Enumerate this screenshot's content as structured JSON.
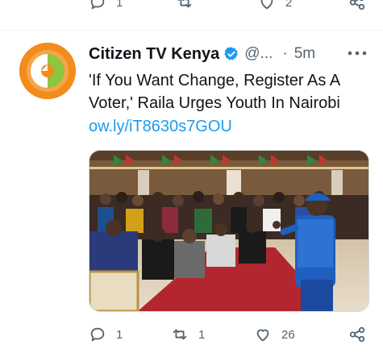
{
  "previous_tweet": {
    "reply_count": "1",
    "like_count": "2"
  },
  "tweet": {
    "author_name": "Citizen TV Kenya",
    "handle": "@...",
    "separator": "·",
    "time": "5m",
    "text": "'If You Want Change, Register As A Voter,' Raila Urges Youth In Nairobi",
    "link": "ow.ly/iT8630s7GOU",
    "reply_count": "1",
    "retweet_count": "1",
    "like_count": "26"
  },
  "colors": {
    "link": "#1d9bf0",
    "verified": "#1d9bf0",
    "muted": "#536471",
    "avatar_orange": "#f28c1c",
    "avatar_green": "#8dc63f"
  }
}
